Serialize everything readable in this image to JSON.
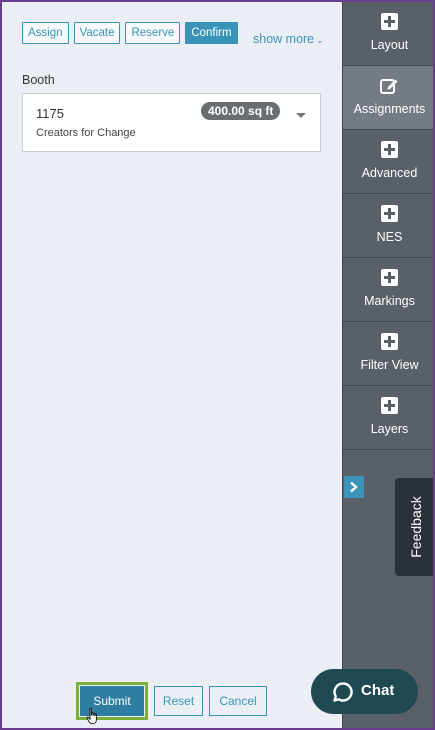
{
  "actions": {
    "assign": "Assign",
    "vacate": "Vacate",
    "reserve": "Reserve",
    "confirm": "Confirm",
    "show_more": "show more"
  },
  "booth": {
    "label": "Booth",
    "number": "1175",
    "size": "400.00 sq ft",
    "exhibitor": "Creators for Change"
  },
  "buttons": {
    "submit": "Submit",
    "reset": "Reset",
    "cancel": "Cancel"
  },
  "sidebar": {
    "items": [
      {
        "label": "Layout",
        "icon": "plus-square-icon"
      },
      {
        "label": "Assignments",
        "icon": "edit-icon",
        "active": true
      },
      {
        "label": "Advanced",
        "icon": "plus-square-icon"
      },
      {
        "label": "NES",
        "icon": "plus-square-icon"
      },
      {
        "label": "Markings",
        "icon": "plus-square-icon"
      },
      {
        "label": "Filter View",
        "icon": "plus-square-icon"
      },
      {
        "label": "Layers",
        "icon": "plus-square-icon"
      }
    ]
  },
  "feedback": "Feedback",
  "chat": "Chat",
  "colors": {
    "accent": "#3a93b8",
    "sidebar": "#5a6068",
    "chat": "#1f4a52",
    "frame": "#6a3d8f"
  }
}
